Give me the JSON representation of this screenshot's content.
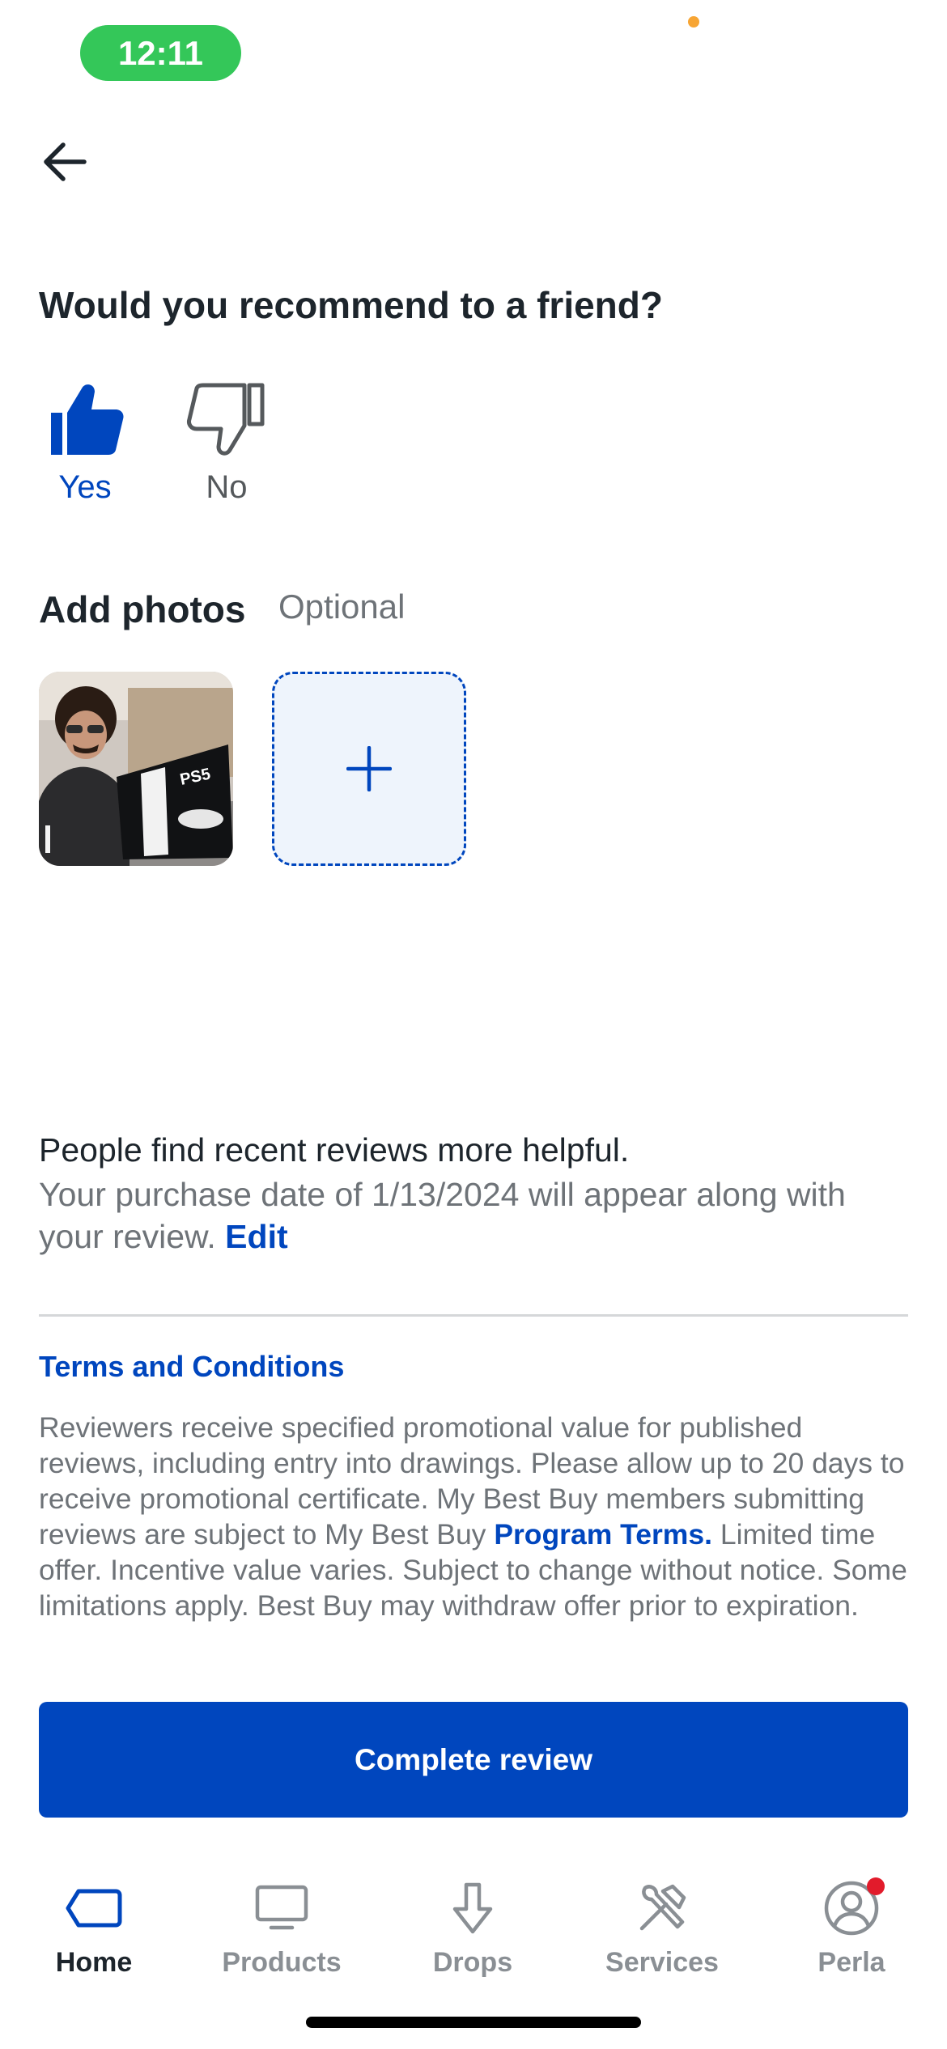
{
  "status_bar": {
    "time": "12:11"
  },
  "recommend": {
    "question": "Would you recommend to a friend?",
    "yes_label": "Yes",
    "no_label": "No",
    "selected": "Yes"
  },
  "photos": {
    "title": "Add photos",
    "optional_label": "Optional",
    "box_text": "PS5"
  },
  "recent": {
    "headline": "People find recent reviews more helpful.",
    "body": "Your purchase date of 1/13/2024 will appear along with your review.",
    "edit_label": "Edit"
  },
  "terms": {
    "title": "Terms and Conditions",
    "body_before_link": "Reviewers receive specified promotional value for published reviews, including entry into drawings. Please allow up to 20 days to receive promotional certificate. My Best Buy members submitting reviews are subject to My Best Buy",
    "link_label": "Program Terms.",
    "body_after_link": "Limited time offer. Incentive value varies. Subject to change without notice. Some limitations apply. Best Buy may withdraw offer prior to expiration."
  },
  "complete_button": "Complete review",
  "tabs": [
    {
      "label": "Home",
      "icon": "tag-icon",
      "active": true
    },
    {
      "label": "Products",
      "icon": "monitor-icon",
      "active": false
    },
    {
      "label": "Drops",
      "icon": "arrow-down-icon",
      "active": false
    },
    {
      "label": "Services",
      "icon": "tools-icon",
      "active": false
    },
    {
      "label": "Perla",
      "icon": "user-icon",
      "active": false,
      "badge": true
    }
  ],
  "colors": {
    "brand_blue": "#0046be",
    "status_green": "#34c759",
    "badge_red": "#e21b2b",
    "muted_text": "#6e7378"
  }
}
